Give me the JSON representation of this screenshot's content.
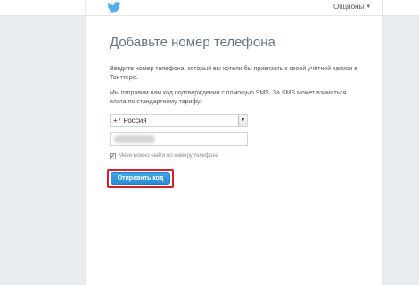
{
  "header": {
    "logo_icon": "twitter-bird-icon",
    "options_label": "Опционы",
    "options_caret_icon": "caret-down-icon"
  },
  "colors": {
    "brand_blue": "#55acee",
    "button_blue": "#3296dc",
    "highlight_red": "#d4202a",
    "background": "#e8ecef"
  },
  "page": {
    "title": "Добавьте номер телефона",
    "intro_text": "Введите номер телефона, который вы хотели бы привязать к своей учётной записи в Твиттере.",
    "sms_text": "Мы отправим вам код подтверждения с помощью SMS. За SMS может взиматься плата по стандартному тарифу."
  },
  "form": {
    "country_select_value": "+7 Россия",
    "country_select_arrow_icon": "dropdown-arrow-icon",
    "phone_value_obscured": true,
    "discoverable_checked": true,
    "discoverable_label": "Меня можно найти по номеру телефона",
    "submit_label": "Отправить код"
  }
}
